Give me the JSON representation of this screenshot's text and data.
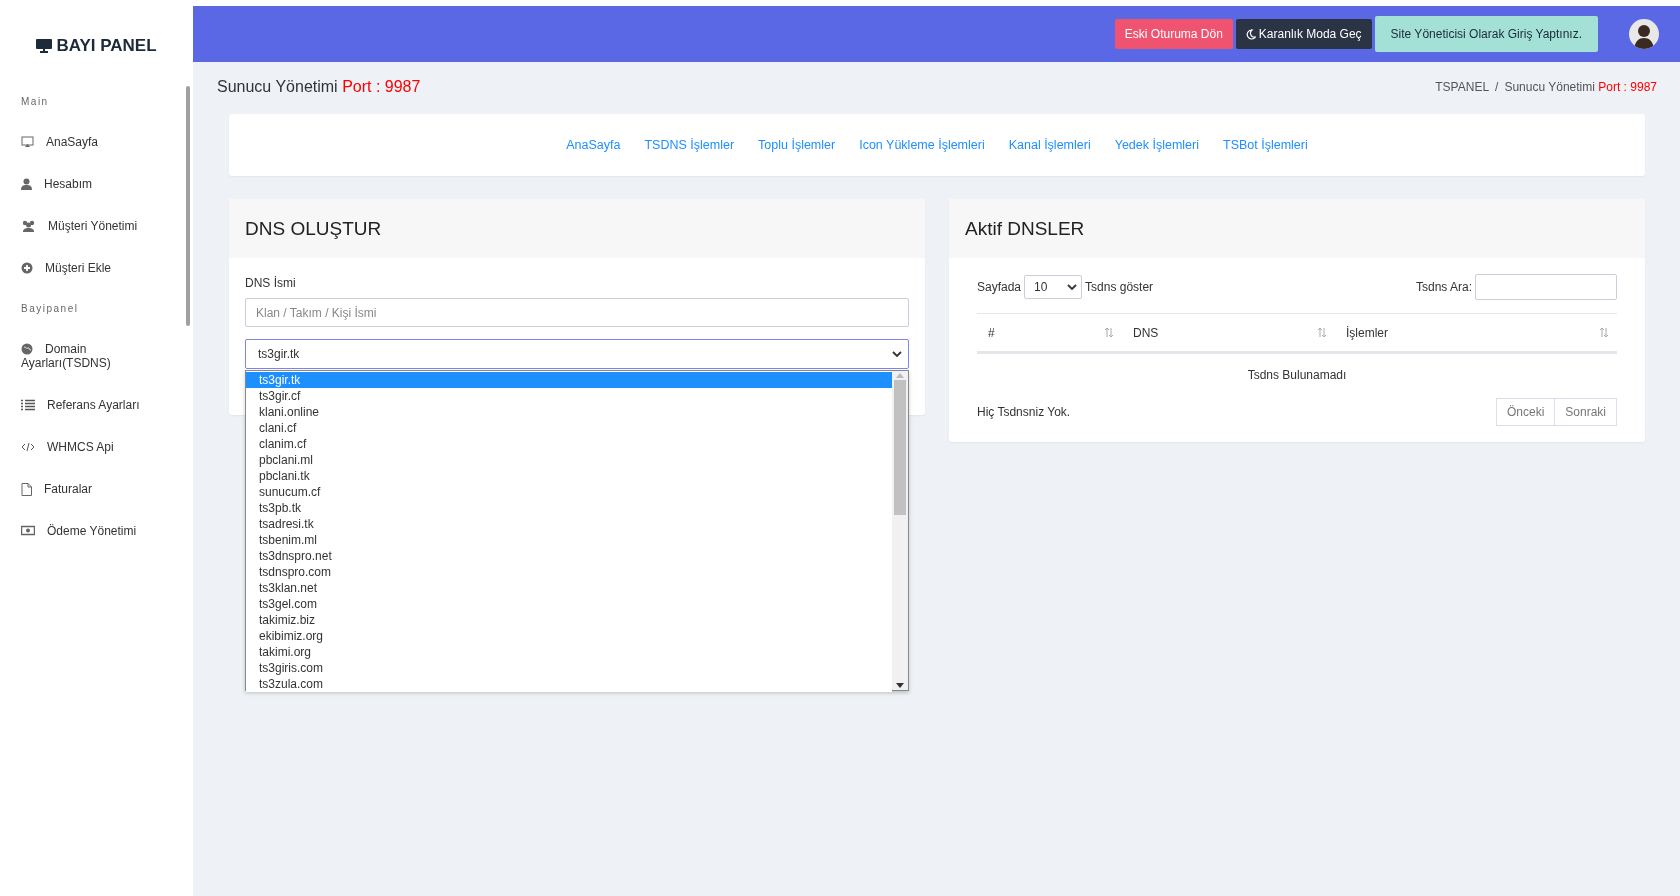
{
  "sidebar": {
    "brand": "BAYI PANEL",
    "sections": [
      {
        "title": "Main",
        "items": [
          {
            "label": "AnaSayfa"
          },
          {
            "label": "Hesabım"
          },
          {
            "label": "Müşteri Yönetimi"
          },
          {
            "label": "Müşteri Ekle"
          }
        ]
      },
      {
        "title": "Bayipanel",
        "items": [
          {
            "label": "Domain Ayarları(TSDNS)"
          },
          {
            "label": "Referans Ayarları"
          },
          {
            "label": "WHMCS Api"
          },
          {
            "label": "Faturalar"
          },
          {
            "label": "Ödeme Yönetimi"
          }
        ]
      }
    ]
  },
  "header": {
    "buttons": [
      {
        "label": "Eski Oturuma Dön",
        "kind": "danger"
      },
      {
        "label": "Karanlık Moda Geç",
        "kind": "dark"
      },
      {
        "label": "Site Yöneticisi Olarak Giriş Yaptınız.",
        "kind": "info"
      }
    ]
  },
  "page_title": {
    "text": "Sunucu Yönetimi",
    "port": "Port : 9987"
  },
  "breadcrumb": {
    "root": "TSPANEL",
    "separator": "/",
    "current": "Sunucu Yönetimi",
    "port": "Port : 9987"
  },
  "nav_links": [
    "AnaSayfa",
    "TSDNS İşlemler",
    "Toplu İşlemler",
    "Icon Yükleme İşlemleri",
    "Kanal İşlemleri",
    "Yedek İşlemleri",
    "TSBot İşlemleri"
  ],
  "dns_form": {
    "title": "DNS OLUŞTUR",
    "label": "DNS İsmi",
    "name_field": {
      "placeholder": "Klan / Takım / Kişi İsmi"
    },
    "domain_select": {
      "value": "ts3gir.tk",
      "expanded": true,
      "options": [
        {
          "label": "ts3gir.tk",
          "selected": true
        },
        {
          "label": "ts3gir.cf",
          "selected": false
        },
        {
          "label": "klani.online",
          "selected": false
        },
        {
          "label": "clani.cf",
          "selected": false
        },
        {
          "label": "clanim.cf",
          "selected": false
        },
        {
          "label": "pbclani.ml",
          "selected": false
        },
        {
          "label": "pbclani.tk",
          "selected": false
        },
        {
          "label": "sunucum.cf",
          "selected": false
        },
        {
          "label": "ts3pb.tk",
          "selected": false
        },
        {
          "label": "tsadresi.tk",
          "selected": false
        },
        {
          "label": "tsbenim.ml",
          "selected": false
        },
        {
          "label": "ts3dnspro.net",
          "selected": false
        },
        {
          "label": "tsdnspro.com",
          "selected": false
        },
        {
          "label": "ts3klan.net",
          "selected": false
        },
        {
          "label": "ts3gel.com",
          "selected": false
        },
        {
          "label": "takimiz.biz",
          "selected": false
        },
        {
          "label": "ekibimiz.org",
          "selected": false
        },
        {
          "label": "takimi.org",
          "selected": false
        },
        {
          "label": "ts3giris.com",
          "selected": false
        },
        {
          "label": "ts3zula.com",
          "selected": false
        }
      ]
    }
  },
  "active_dns": {
    "title": "Aktif DNSLER",
    "page_size_label": "Sayfada",
    "page_size": "10",
    "page_size_suffix": "Tsdns göster",
    "search_label": "Tsdns Ara:",
    "columns": [
      "#",
      "DNS",
      "İşlemler"
    ],
    "empty_message": "Tsdns Bulunamadı",
    "info": "Hiç Tsdnsniz Yok.",
    "pager": [
      "Önceki",
      "Sonraki"
    ]
  }
}
